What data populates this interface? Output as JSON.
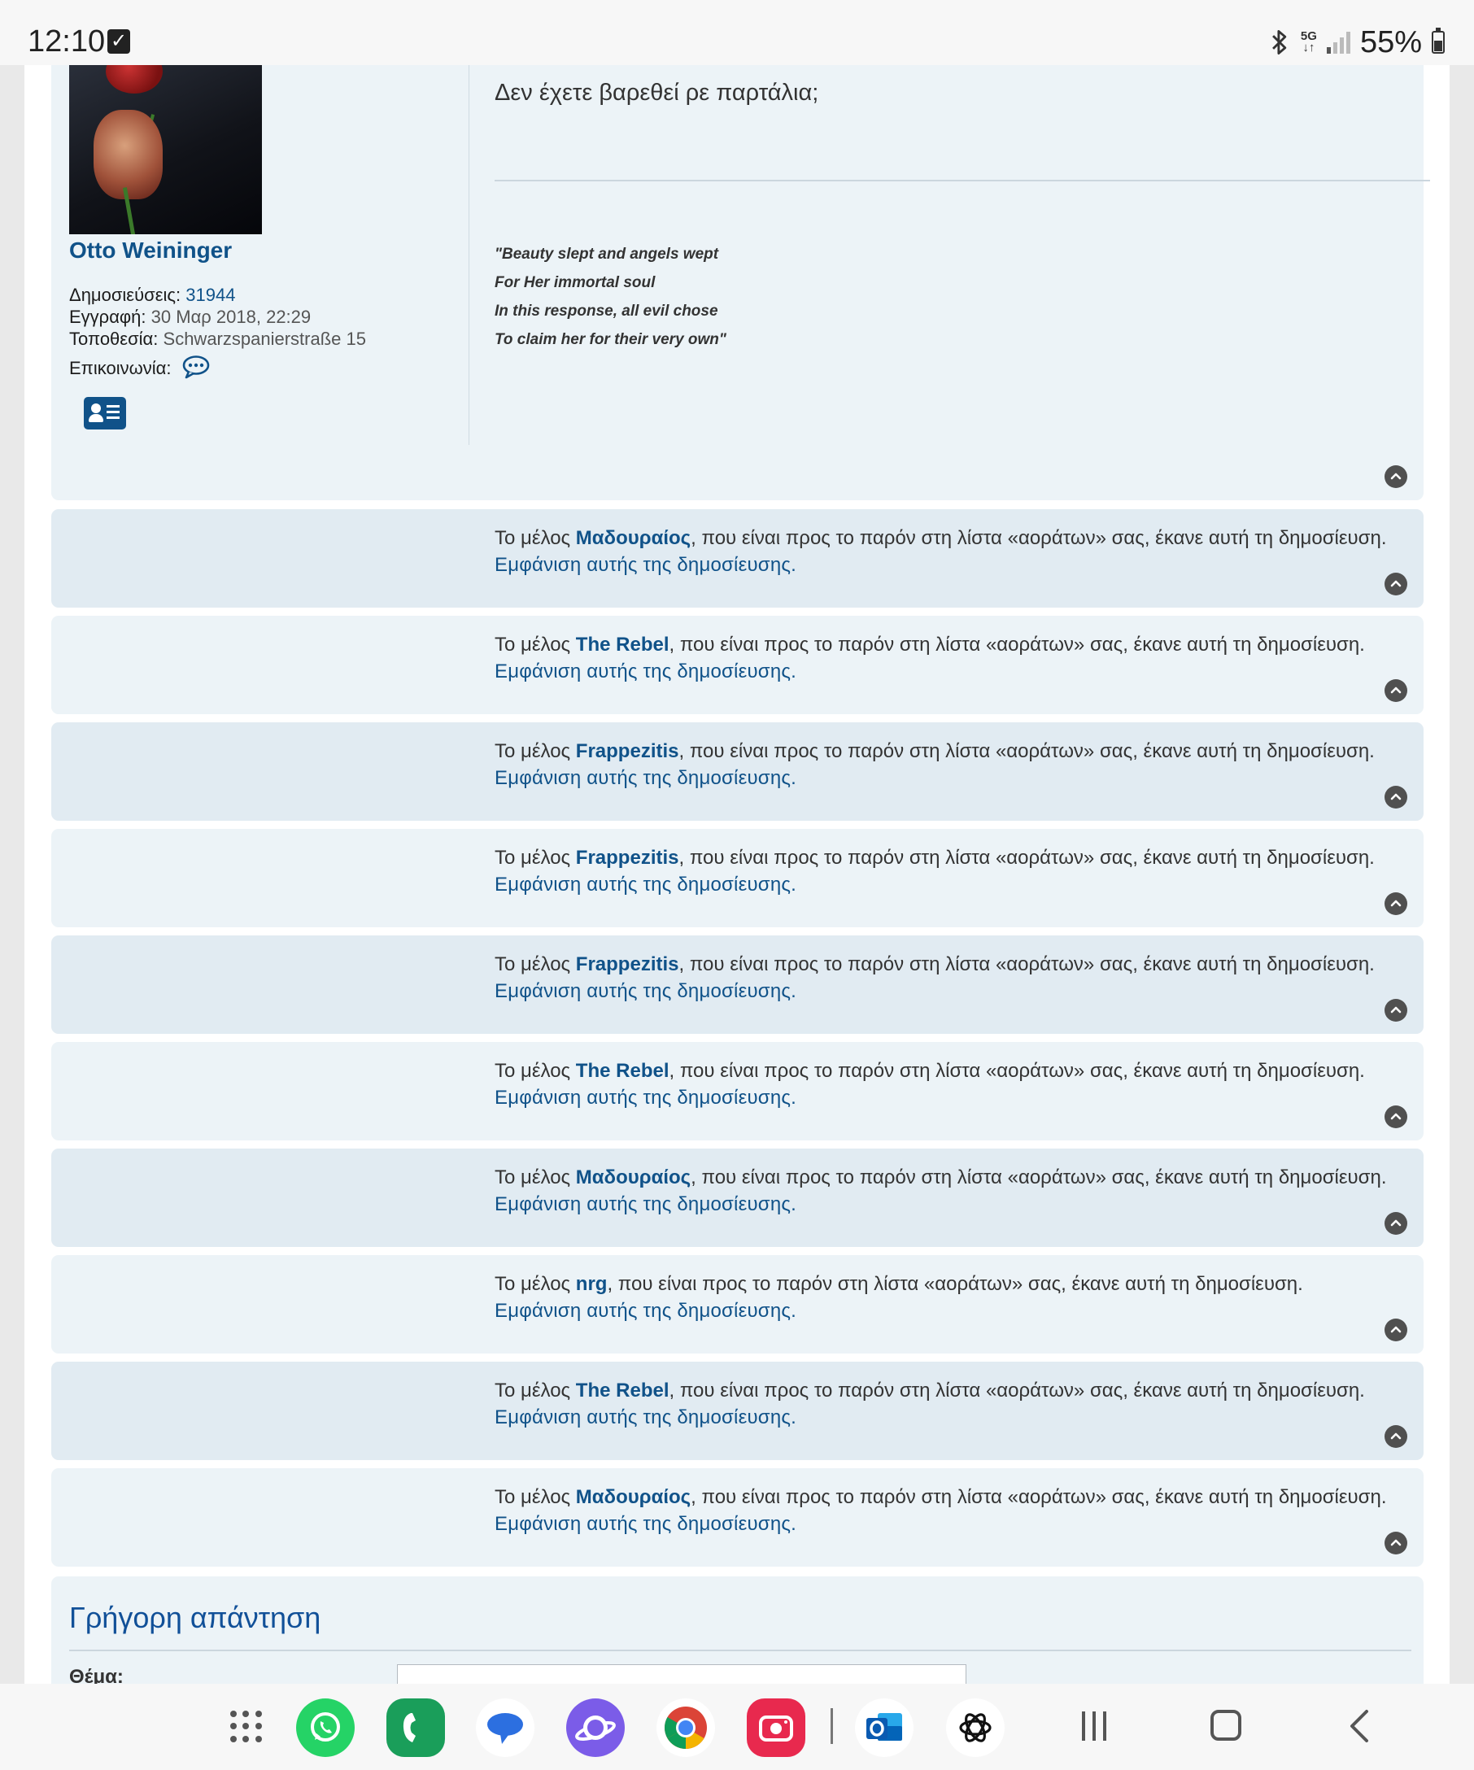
{
  "status_bar": {
    "time": "12:10",
    "network": "5G",
    "battery": "55%"
  },
  "main_post": {
    "author": "Otto Weininger",
    "profile": {
      "posts_label": "Δημοσιεύσεις:",
      "posts_value": "31944",
      "joined_label": "Εγγραφή:",
      "joined_value": "30 Μαρ 2018, 22:29",
      "location_label": "Τοποθεσία:",
      "location_value": "Schwarzspanierstraße 15",
      "contact_label": "Επικοινωνία:"
    },
    "text": "Δεν έχετε βαρεθεί ρε παρτάλια;",
    "signature": [
      "\"Beauty slept and angels wept",
      "For Her immortal soul",
      "In this response, all evil chose",
      "To claim her for their very own\""
    ]
  },
  "ignored_posts": {
    "prefix": "Το μέλος ",
    "suffix": ", που είναι προς το παρόν στη λίστα «αοράτων» σας, έκανε αυτή τη δημοσίευση.",
    "show_link": "Εμφάνιση αυτής της δημοσίευσης.",
    "members": [
      "Μαδουραίος",
      "The Rebel",
      "Frappezitis",
      "Frappezitis",
      "Frappezitis",
      "The Rebel",
      "Μαδουραίος",
      "nrg",
      "The Rebel",
      "Μαδουραίος"
    ]
  },
  "quick_reply": {
    "title": "Γρήγορη απάντηση",
    "subject_label": "Θέμα:"
  },
  "colors": {
    "link": "#105289",
    "row_dark": "#e1ebf2",
    "row_light": "#ecf3f7"
  },
  "nav_apps": [
    "apps-grid-icon",
    "whatsapp-icon",
    "phone-icon",
    "messages-icon",
    "samsung-internet-icon",
    "chrome-icon",
    "camera-icon",
    "outlook-icon",
    "chatgpt-icon"
  ]
}
